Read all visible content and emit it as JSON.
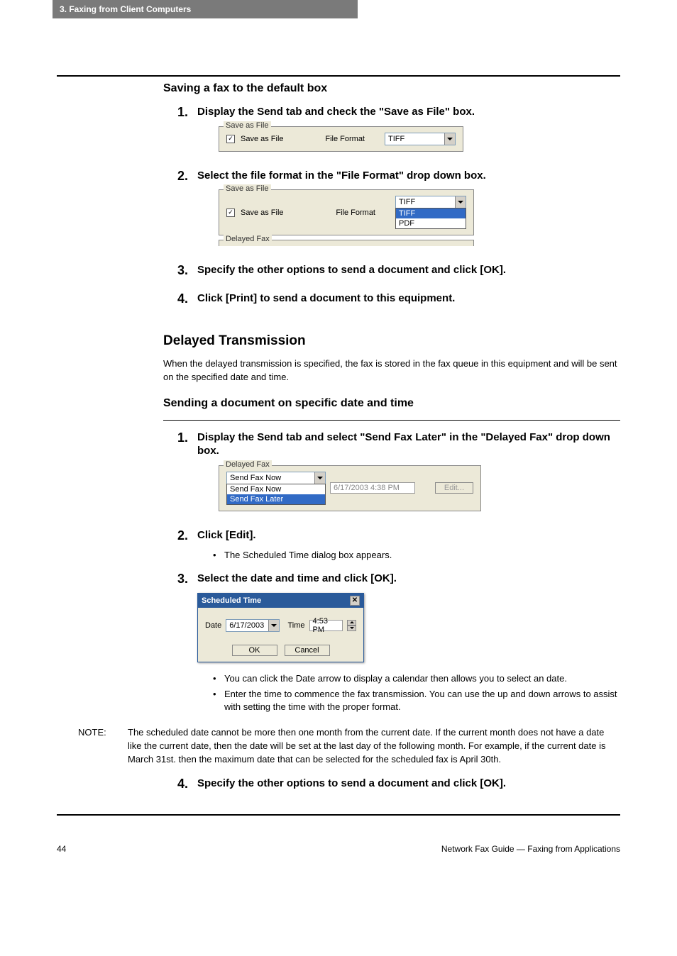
{
  "header": {
    "chapter": "3. Faxing from Client Computers"
  },
  "section_saving": {
    "title": "Saving a fax to the default box",
    "steps": [
      {
        "num": "1.",
        "title": "Display the Send tab and check the \"Save as File\" box."
      },
      {
        "num": "2.",
        "title": "Select the file format in the \"File Format\" drop down box."
      },
      {
        "num": "3.",
        "title": "Specify the other options to send a document and click [OK]."
      },
      {
        "num": "4.",
        "title": "Click [Print] to send a document to this equipment."
      }
    ]
  },
  "ui_save_as_file": {
    "legend": "Save as File",
    "checkbox_label": "Save as File",
    "file_format_label": "File Format",
    "selected": "TIFF",
    "options": [
      "TIFF",
      "PDF"
    ]
  },
  "section_delayed": {
    "heading": "Delayed Transmission",
    "intro": "When the delayed transmission is specified, the fax is stored in the fax queue in this equipment and will be sent on the specified date and time.",
    "subheading": "Sending a document on specific date and time",
    "steps": [
      {
        "num": "1.",
        "title": "Display the Send tab and select \"Send Fax Later\" in the \"Delayed Fax\" drop down box."
      },
      {
        "num": "2.",
        "title": "Click [Edit].",
        "bullets": [
          "The Scheduled Time dialog box appears."
        ]
      },
      {
        "num": "3.",
        "title": "Select the date and time and click [OK].",
        "bullets": [
          "You can click the Date arrow to display a calendar then allows you to select an date.",
          "Enter the time to commence the fax transmission. You can use the up and down arrows to assist with setting the time with the proper format."
        ]
      },
      {
        "num": "4.",
        "title": "Specify the other options to send a document and click [OK]."
      }
    ]
  },
  "ui_delayed_fax": {
    "legend": "Delayed Fax",
    "selected": "Send Fax Now",
    "options": [
      "Send Fax Now",
      "Send Fax Later"
    ],
    "datetime": "6/17/2003 4:38 PM",
    "edit_label": "Edit..."
  },
  "ui_scheduled_time": {
    "title": "Scheduled Time",
    "date_label": "Date",
    "date_value": "6/17/2003",
    "time_label": "Time",
    "time_value": "4:53 PM",
    "ok": "OK",
    "cancel": "Cancel"
  },
  "note": {
    "label": "NOTE:",
    "text": "The scheduled date cannot be more then one month from the current date.  If the current month does not have a date like the current date, then the date will be set at the last day of the following month. For example, if the current date is March 31st. then the maximum date that can be selected for the scheduled fax is April 30th."
  },
  "footer": {
    "page": "44",
    "title": "Network Fax Guide — Faxing from Applications"
  }
}
